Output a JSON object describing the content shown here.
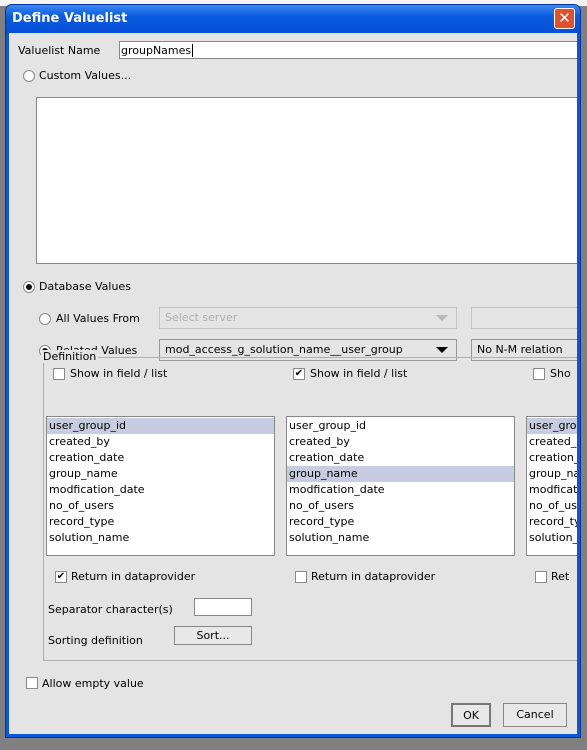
{
  "dialog": {
    "title": "Define Valuelist",
    "close_icon": "close-icon"
  },
  "name": {
    "label": "Valuelist Name",
    "value": "groupNames"
  },
  "custom": {
    "label": "Custom Values...",
    "selected": false
  },
  "database": {
    "label": "Database Values",
    "selected": true
  },
  "all_values": {
    "label": "All Values From",
    "selected": false,
    "server_placeholder": "Select server"
  },
  "related": {
    "label": "Related Values",
    "selected": true,
    "relation": "mod_access_g_solution_name__user_group",
    "nm": "No N-M relation"
  },
  "definition": {
    "legend": "Definition",
    "columns": [
      {
        "show_label": "Show in field / list",
        "show": false,
        "return_label": "Return in dataprovider",
        "return": true,
        "selected": "user_group_id"
      },
      {
        "show_label": "Show in field / list",
        "show": true,
        "return_label": "Return in dataprovider",
        "return": false,
        "selected": "group_name"
      },
      {
        "show_label": "Sho",
        "show": false,
        "return_label": "Ret",
        "return": false,
        "selected": "user_group_id"
      }
    ],
    "fields": [
      "user_group_id",
      "created_by",
      "creation_date",
      "group_name",
      "modfication_date",
      "no_of_users",
      "record_type",
      "solution_name"
    ],
    "fields_clipped": [
      "user_group",
      "created_by",
      "creation_da",
      "group_nam",
      "modfication",
      "no_of_use",
      "record_typ",
      "solution_na"
    ],
    "separator_label": "Separator character(s)",
    "separator_value": "",
    "sorting_label": "Sorting definition",
    "sort_button": "Sort..."
  },
  "allow_empty": {
    "label": "Allow empty value",
    "checked": false
  },
  "buttons": {
    "ok": "OK",
    "cancel": "Cancel"
  }
}
